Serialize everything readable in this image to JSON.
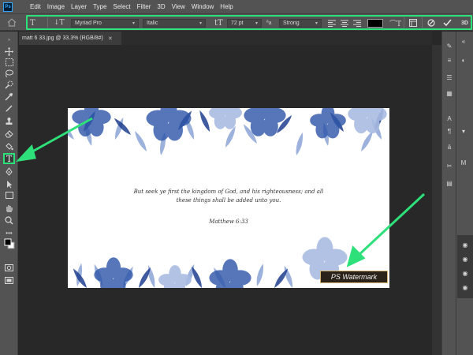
{
  "menu": {
    "logo": "Ps",
    "items": [
      "Edit",
      "Image",
      "Layer",
      "Type",
      "Select",
      "Filter",
      "3D",
      "View",
      "Window",
      "Help"
    ]
  },
  "options": {
    "font_family": "Myriad Pro",
    "font_style": "Italic",
    "font_size": "72 pt",
    "antialias": "Strong",
    "text_color": "#000000",
    "three_d_label": "3D"
  },
  "document": {
    "tab_title": "matt 6 33.jpg @ 33.3% (RGB/8#)",
    "verse_line1": "But seek ye first the kingdom of God, and his righteousness; and all",
    "verse_line2": "these things shall be added unto you.",
    "reference": "Matthew 6:33",
    "watermark": "PS Watermark"
  },
  "colors": {
    "highlight": "#2ee07a",
    "flower_dark": "#1f3f8f",
    "flower_light": "#7c98cf"
  }
}
